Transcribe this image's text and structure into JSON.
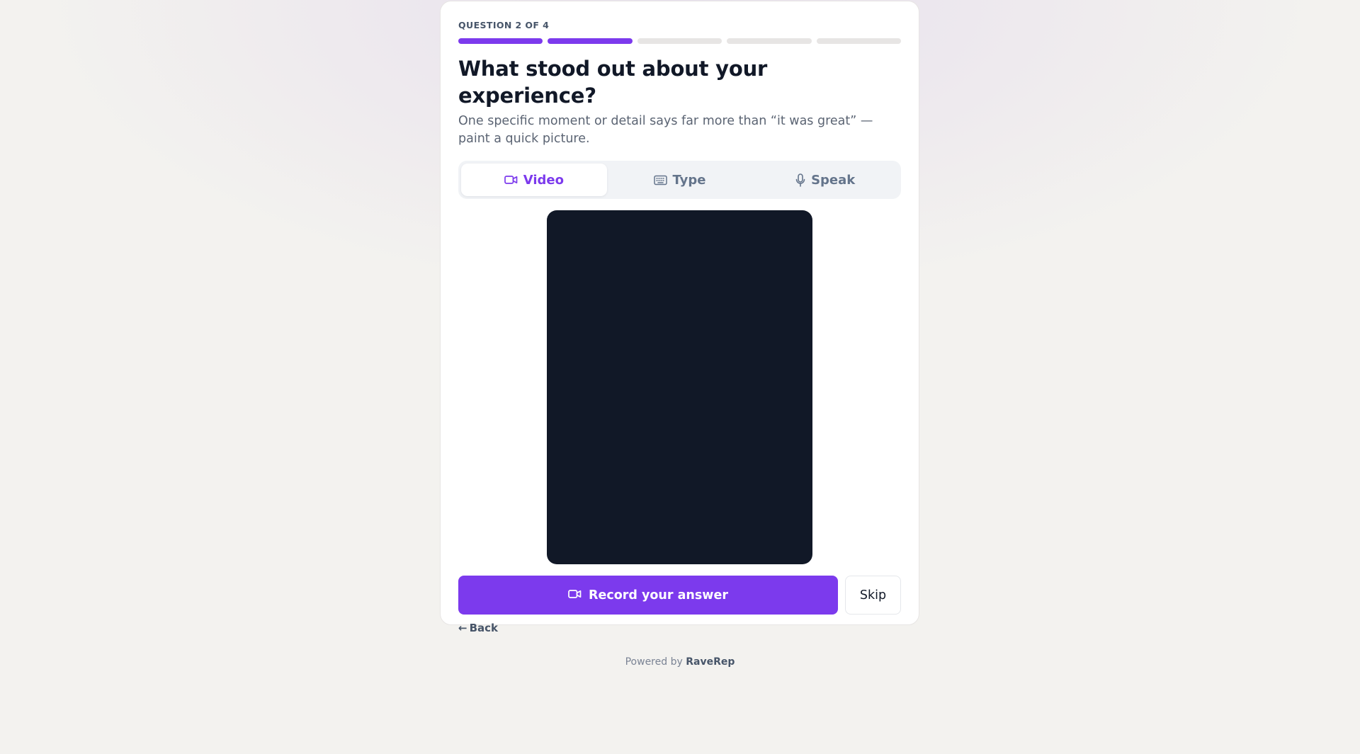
{
  "survey": {
    "question_label": "QUESTION 2 OF 4",
    "progress": {
      "current": 2,
      "total": 5
    },
    "title": "What stood out about your experience?",
    "subtitle": "One specific moment or detail says far more than “it was great” — paint a quick picture."
  },
  "tabs": [
    {
      "label": "Video",
      "icon": "video-camera-icon",
      "active": true
    },
    {
      "label": "Type",
      "icon": "keyboard-icon",
      "active": false
    },
    {
      "label": "Speak",
      "icon": "microphone-icon",
      "active": false
    }
  ],
  "actions": {
    "record_label": "Record your answer",
    "record_icon": "video-camera-icon",
    "skip_label": "Skip",
    "back_arrow": "←",
    "back_label": "Back"
  },
  "footer": {
    "powered_by": "Powered by",
    "brand": "RaveRep"
  },
  "colors": {
    "accent": "#7c3aed",
    "video_background": "#111827",
    "page_background": "#f3f2ef"
  }
}
